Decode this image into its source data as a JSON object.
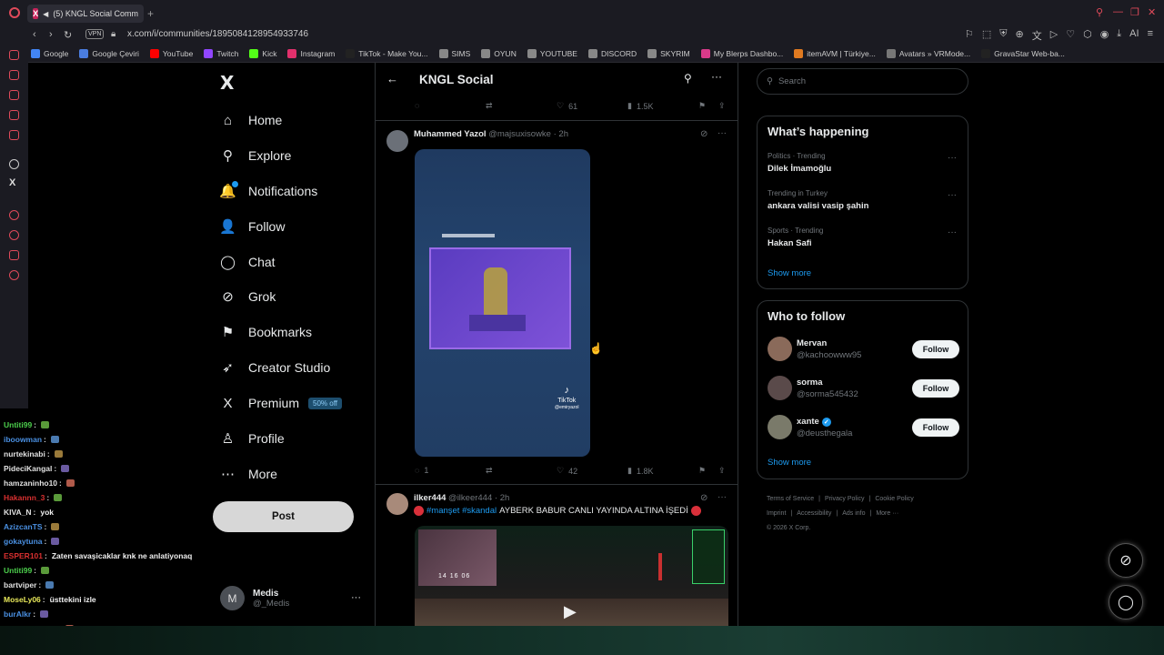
{
  "browser": {
    "tab_title": "(5) KNGL Social Comm",
    "new_tab": "+",
    "vpn_label": "VPN",
    "url": "x.com/i/communities/1895084128954933746",
    "bookmarks": [
      {
        "label": "Google",
        "color": "#4285f4"
      },
      {
        "label": "Google Çeviri",
        "color": "#4a7de0"
      },
      {
        "label": "YouTube",
        "color": "#ff0000"
      },
      {
        "label": "Twitch",
        "color": "#9146ff"
      },
      {
        "label": "Kick",
        "color": "#53fc18"
      },
      {
        "label": "Instagram",
        "color": "#e1306c"
      },
      {
        "label": "TikTok - Make You...",
        "color": "#222"
      },
      {
        "label": "SIMS",
        "color": "#888"
      },
      {
        "label": "OYUN",
        "color": "#888"
      },
      {
        "label": "YOUTUBE",
        "color": "#888"
      },
      {
        "label": "DISCORD",
        "color": "#888"
      },
      {
        "label": "SKYRIM",
        "color": "#888"
      },
      {
        "label": "My Blerps Dashbo...",
        "color": "#d93a8a"
      },
      {
        "label": "itemAVM | Türkiye...",
        "color": "#e07a20"
      },
      {
        "label": "Avatars » VRMode...",
        "color": "#777"
      },
      {
        "label": "GravaStar Web-ba...",
        "color": "#222"
      }
    ]
  },
  "nav": {
    "logo": "X",
    "items": [
      {
        "label": "Home",
        "icon": "home-icon",
        "glyph": "⌂"
      },
      {
        "label": "Explore",
        "icon": "search-icon",
        "glyph": "⚲"
      },
      {
        "label": "Notifications",
        "icon": "bell-icon",
        "glyph": "🔔"
      },
      {
        "label": "Follow",
        "icon": "person-add-icon",
        "glyph": "👤"
      },
      {
        "label": "Chat",
        "icon": "chat-icon",
        "glyph": "◯"
      },
      {
        "label": "Grok",
        "icon": "grok-icon",
        "glyph": "⊘"
      },
      {
        "label": "Bookmarks",
        "icon": "bookmark-icon",
        "glyph": "⚑"
      },
      {
        "label": "Creator Studio",
        "icon": "rocket-icon",
        "glyph": "➶"
      },
      {
        "label": "Premium",
        "icon": "x-premium-icon",
        "glyph": "X"
      },
      {
        "label": "Profile",
        "icon": "profile-icon",
        "glyph": "♙"
      },
      {
        "label": "More",
        "icon": "more-circle-icon",
        "glyph": "⋯"
      }
    ],
    "premium_badge": "50% off",
    "post_button": "Post",
    "account": {
      "initial": "M",
      "name": "Medis",
      "handle": "@_Medis",
      "more": "···"
    }
  },
  "chat": [
    {
      "user": "Untiti99",
      "msg": "",
      "color": "#4ccf4c"
    },
    {
      "user": "iboowman",
      "msg": "",
      "color": "#4a90e2"
    },
    {
      "user": "nurtekinabi",
      "msg": "",
      "color": "#e0e0e0"
    },
    {
      "user": "PideciKangal",
      "msg": "",
      "color": "#e0e0e0"
    },
    {
      "user": "hamzaninho10",
      "msg": "",
      "color": "#e0e0e0"
    },
    {
      "user": "Hakannn_3",
      "msg": "",
      "color": "#d93030"
    },
    {
      "user": "KIVA_N",
      "msg": "yok",
      "color": "#e0e0e0"
    },
    {
      "user": "AzizcanTS",
      "msg": "",
      "color": "#4a90e2"
    },
    {
      "user": "gokaytuna",
      "msg": "",
      "color": "#4a90e2"
    },
    {
      "user": "ESPER101",
      "msg": "Zaten savaşicaklar knk ne anlatiyonaq",
      "color": "#d93030"
    },
    {
      "user": "Untiti99",
      "msg": "",
      "color": "#4ccf4c"
    },
    {
      "user": "bartviper",
      "msg": "",
      "color": "#e0e0e0"
    },
    {
      "user": "MoseLy06",
      "msg": "üsttekini izle",
      "color": "#e8e85a"
    },
    {
      "user": "burAlkr",
      "msg": "",
      "color": "#4a90e2"
    },
    {
      "user": "AlperenSPH10",
      "msg": "",
      "color": "#4ccf4c"
    }
  ],
  "community": {
    "title": "KNGL Social"
  },
  "prev_post_actions": {
    "replies": "",
    "reposts": "",
    "likes": "61",
    "views": "1.5K"
  },
  "posts": [
    {
      "name": "Muhammed Yazol",
      "handle": "@majsuxisowke",
      "time": "· 2h",
      "media_label": "TikTok",
      "media_handle": "@emiryazol",
      "replies": "1",
      "reposts": "",
      "likes": "42",
      "views": "1.8K"
    },
    {
      "name": "ilker444",
      "handle": "@ilkeer444",
      "time": "· 2h",
      "hashtags": "#manşet #skandal",
      "headline": "AYBERK BABUR CANLI YAYINDA ALTINA İŞEDİ",
      "media_time": "14 16 06"
    }
  ],
  "right": {
    "search_placeholder": "Search",
    "trends_title": "What’s happening",
    "trends": [
      {
        "category": "Politics · Trending",
        "name": "Dilek İmamoğlu"
      },
      {
        "category": "Trending in Turkey",
        "name": "ankara valisi vasip şahin"
      },
      {
        "category": "Sports · Trending",
        "name": "Hakan Safi"
      }
    ],
    "show_more": "Show more",
    "wtf_title": "Who to follow",
    "who_to_follow": [
      {
        "name": "Mervan",
        "handle": "@kachoowww95",
        "verified": false,
        "color": "#8a6a5a"
      },
      {
        "name": "sorma",
        "handle": "@sorma545432",
        "verified": false,
        "color": "#5a4a4a"
      },
      {
        "name": "xante",
        "handle": "@deusthegala",
        "verified": true,
        "color": "#7a7a6a"
      }
    ],
    "follow_label": "Follow",
    "footer": [
      "Terms of Service",
      "Privacy Policy",
      "Cookie Policy",
      "Imprint",
      "Accessibility",
      "Ads info",
      "More ···"
    ],
    "copyright": "© 2026 X Corp."
  }
}
